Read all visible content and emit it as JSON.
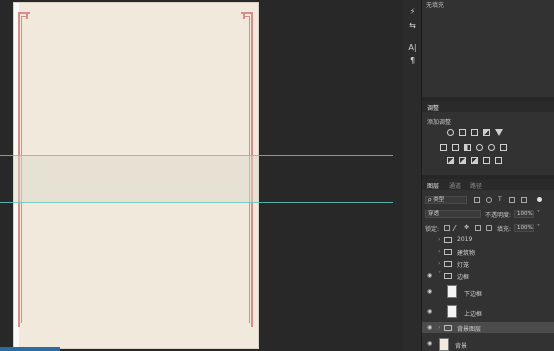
{
  "top_panel": {
    "text": "无填充"
  },
  "tools": [
    {
      "icon": "brush-adjust-icon",
      "glyph": "⚡"
    },
    {
      "icon": "sliders-icon",
      "glyph": "⇆"
    },
    {
      "icon": "character-icon",
      "glyph": "A|"
    },
    {
      "icon": "paragraph-icon",
      "glyph": "¶"
    }
  ],
  "adjustments": {
    "tab": "调整",
    "add_label": "添加调整"
  },
  "layers_panel": {
    "tabs": [
      "图层",
      "通道",
      "路径"
    ],
    "filter_kind": "ρ 类型",
    "blend_mode": "穿透",
    "opacity_label": "不透明度:",
    "opacity_value": "100%",
    "lock_label": "锁定:",
    "fill_label": "填充:",
    "fill_value": "100%",
    "layers": [
      {
        "name": "2019",
        "visible": false,
        "type": "group"
      },
      {
        "name": "建筑物",
        "visible": false,
        "type": "group"
      },
      {
        "name": "灯笼",
        "visible": false,
        "type": "group"
      },
      {
        "name": "边框",
        "visible": true,
        "type": "group",
        "expanded": true
      },
      {
        "name": "下边框",
        "visible": true,
        "type": "smart"
      },
      {
        "name": "上边框",
        "visible": true,
        "type": "smart"
      },
      {
        "name": "背景图层",
        "visible": true,
        "type": "group",
        "selected": true
      },
      {
        "name": "背景",
        "visible": true,
        "type": "pixel"
      }
    ]
  },
  "colors": {
    "paper": "#f1e9dc",
    "frame": "#d98c8c",
    "guide": "#5fc9c0",
    "panel": "#323232"
  }
}
